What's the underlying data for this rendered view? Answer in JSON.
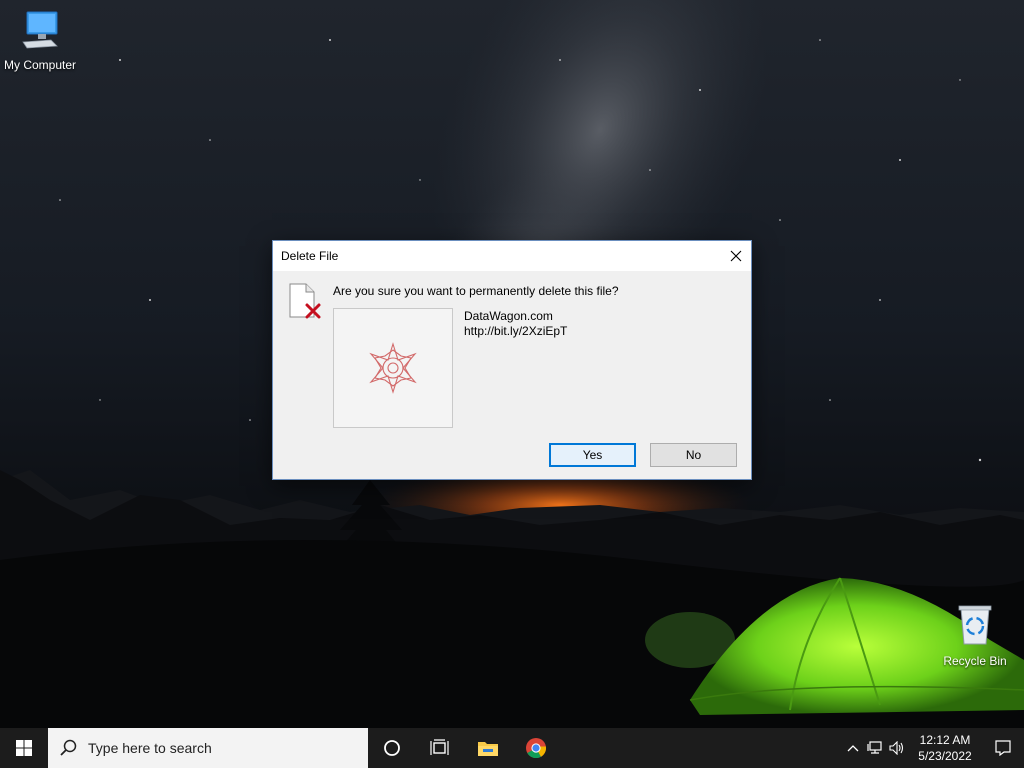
{
  "desktop": {
    "icons": [
      {
        "label": "My Computer",
        "icon": "computer-icon"
      },
      {
        "label": "Recycle Bin",
        "icon": "recycle-bin-icon"
      }
    ]
  },
  "dialog": {
    "title": "Delete File",
    "question": "Are you sure you want to permanently delete this file?",
    "file_name": "DataWagon.com",
    "file_url": "http://bit.ly/2XziEpT",
    "yes_label": "Yes",
    "no_label": "No",
    "accent_color": "#0078d7",
    "delete_color": "#c50f1f"
  },
  "taskbar": {
    "search_placeholder": "Type here to search",
    "pinned": [
      "cortana-icon",
      "task-view-icon",
      "file-explorer-icon",
      "chrome-icon"
    ],
    "clock_time": "12:12 AM",
    "clock_date": "5/23/2022"
  }
}
